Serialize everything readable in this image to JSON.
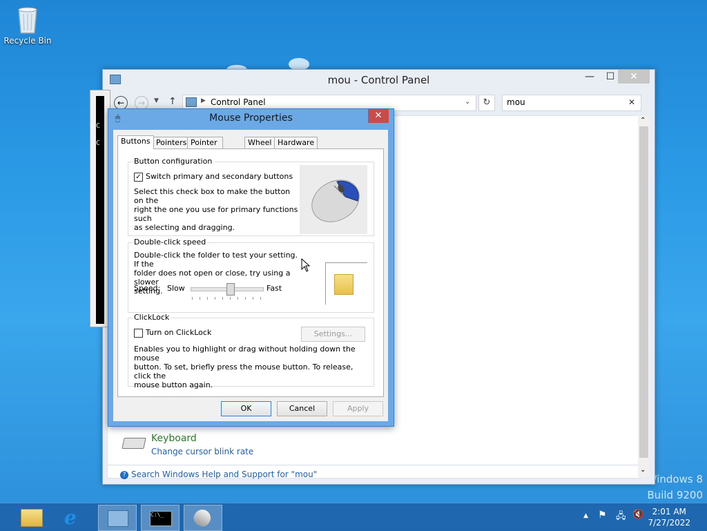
{
  "desktop": {
    "recycle_bin_label": "Recycle Bin",
    "watermark_line1": "Windows 8",
    "watermark_line2": "Build 9200"
  },
  "control_panel": {
    "title": "mou - Control Panel",
    "breadcrumb": "Control Panel",
    "search_value": "mou",
    "keyboard_title": "Keyboard",
    "keyboard_link": "Change cursor blink rate",
    "help_link": "Search Windows Help and Support for \"mou\""
  },
  "cmd": {
    "fragments": [
      "C",
      "C"
    ]
  },
  "dialog": {
    "title": "Mouse Properties",
    "tabs": [
      "Buttons",
      "Pointers",
      "Pointer Options",
      "Wheel",
      "Hardware"
    ],
    "button_config": {
      "heading": "Button configuration",
      "checkbox_label": "Switch primary and secondary buttons",
      "checked": true,
      "desc1": "Select this check box to make the button on the",
      "desc2": "right the one you use for primary functions such",
      "desc3": "as selecting and dragging."
    },
    "double_click": {
      "heading": "Double-click speed",
      "desc1": "Double-click the folder to test your setting. If the",
      "desc2": "folder does not open or close, try using a slower",
      "desc3": "setting.",
      "speed_label": "Speed:",
      "slow_label": "Slow",
      "fast_label": "Fast",
      "speed_level": 0.55
    },
    "clicklock": {
      "heading": "ClickLock",
      "checkbox_label": "Turn on ClickLock",
      "checked": false,
      "settings_button": "Settings...",
      "desc1": "Enables you to highlight or drag without holding down the mouse",
      "desc2": "button. To set, briefly press the mouse button. To release, click the",
      "desc3": "mouse button again."
    },
    "ok_label": "OK",
    "cancel_label": "Cancel",
    "apply_label": "Apply"
  },
  "taskbar": {
    "time": "2:01 AM",
    "date": "7/27/2022"
  },
  "colors": {
    "desktop_blue": "#2c9be6",
    "dialog_frame": "#6aa9e6",
    "close_red": "#c94c4c",
    "link_green": "#2a7a2a",
    "link_blue": "#1e5fb4"
  }
}
